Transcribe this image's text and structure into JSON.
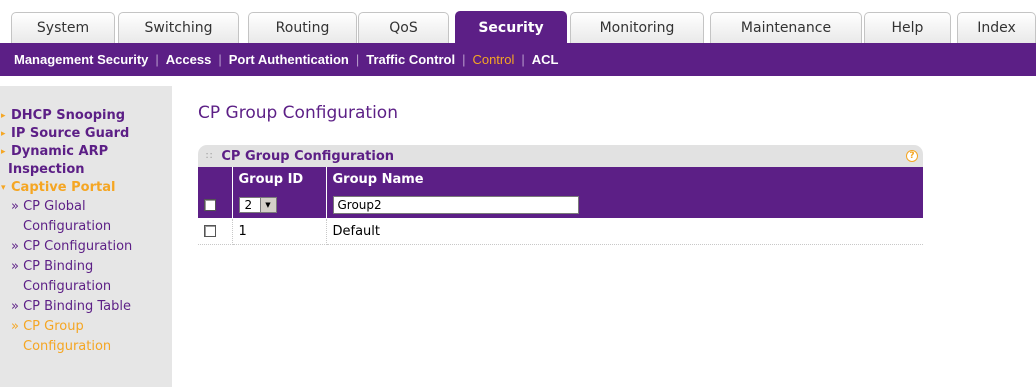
{
  "top_tabs": [
    {
      "label": "System",
      "active": false
    },
    {
      "label": "Switching",
      "active": false
    },
    {
      "label": "Routing",
      "active": false
    },
    {
      "label": "QoS",
      "active": false
    },
    {
      "label": "Security",
      "active": true
    },
    {
      "label": "Monitoring",
      "active": false
    },
    {
      "label": "Maintenance",
      "active": false
    },
    {
      "label": "Help",
      "active": false
    },
    {
      "label": "Index",
      "active": false
    }
  ],
  "sub_nav": [
    {
      "label": "Management Security",
      "active": false
    },
    {
      "label": "Access",
      "active": false
    },
    {
      "label": "Port Authentication",
      "active": false
    },
    {
      "label": "Traffic Control",
      "active": false
    },
    {
      "label": "Control",
      "active": true
    },
    {
      "label": "ACL",
      "active": false
    }
  ],
  "sidebar": {
    "dhcp_snooping": "DHCP Snooping",
    "ip_source_guard": "IP Source Guard",
    "dynamic_arp_1": "Dynamic ARP",
    "dynamic_arp_2": "Inspection",
    "captive_portal": "Captive Portal",
    "cp_global_1": "» CP Global",
    "cp_global_2": "Configuration",
    "cp_configuration": "» CP Configuration",
    "cp_binding_1": "» CP Binding",
    "cp_binding_2": "Configuration",
    "cp_binding_table": "» CP Binding Table",
    "cp_group_1": "» CP Group",
    "cp_group_2": "Configuration"
  },
  "page_title": "CP Group Configuration",
  "panel": {
    "title": "CP Group Configuration",
    "help": "?",
    "columns": {
      "group_id": "Group ID",
      "group_name": "Group Name"
    },
    "edit_row": {
      "group_id": "2",
      "group_name": "Group2"
    },
    "rows": [
      {
        "group_id": "1",
        "group_name": "Default"
      }
    ]
  },
  "colors": {
    "brand_purple": "#5c1f86",
    "accent_orange": "#f5a623"
  }
}
